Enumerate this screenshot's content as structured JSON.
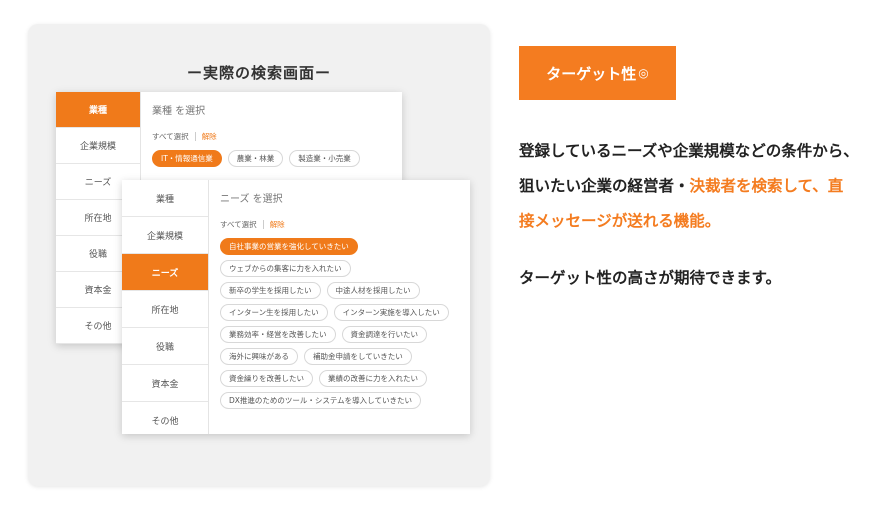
{
  "shot_title": "ー実際の検索画面ー",
  "back_panel": {
    "sidebar": [
      "業種",
      "企業規模",
      "ニーズ",
      "所在地",
      "役職",
      "資本金",
      "その他"
    ],
    "active_index": 0,
    "content_title": "業種 を選択",
    "select_all": "すべて選択",
    "clear": "解除",
    "chips": [
      "IT・情報通信業",
      "農業・林業",
      "製造業・小売業"
    ]
  },
  "front_panel": {
    "sidebar": [
      "業種",
      "企業規模",
      "ニーズ",
      "所在地",
      "役職",
      "資本金",
      "その他"
    ],
    "active_index": 2,
    "content_title": "ニーズ を選択",
    "select_all": "すべて選択",
    "clear": "解除",
    "chip_rows": [
      [
        "自社事業の営業を強化していきたい"
      ],
      [
        "ウェブからの集客に力を入れたい"
      ],
      [
        "新卒の学生を採用したい",
        "中途人材を採用したい"
      ],
      [
        "インターン生を採用したい",
        "インターン実施を導入したい"
      ],
      [
        "業務効率・経営を改善したい",
        "資金調達を行いたい"
      ],
      [
        "海外に興味がある",
        "補助金申請をしていきたい"
      ],
      [
        "資金繰りを改善したい",
        "業績の改善に力を入れたい"
      ],
      [
        "DX推進のためのツール・システムを導入していきたい"
      ]
    ]
  },
  "tag_button": {
    "label": "ターゲット性",
    "mark": "◎"
  },
  "description": {
    "line1": "登録しているニーズや企業規模などの条件から、",
    "line2_plain": "狙いたい企業の経営者・",
    "line2_highlight": "決裁者を検索して、直",
    "line3_highlight": "接メッセージが送れる機能。"
  },
  "note": "ターゲット性の高さが期待できます。",
  "colors": {
    "accent": "#f47c20",
    "card_bg": "#f1f1f1"
  }
}
